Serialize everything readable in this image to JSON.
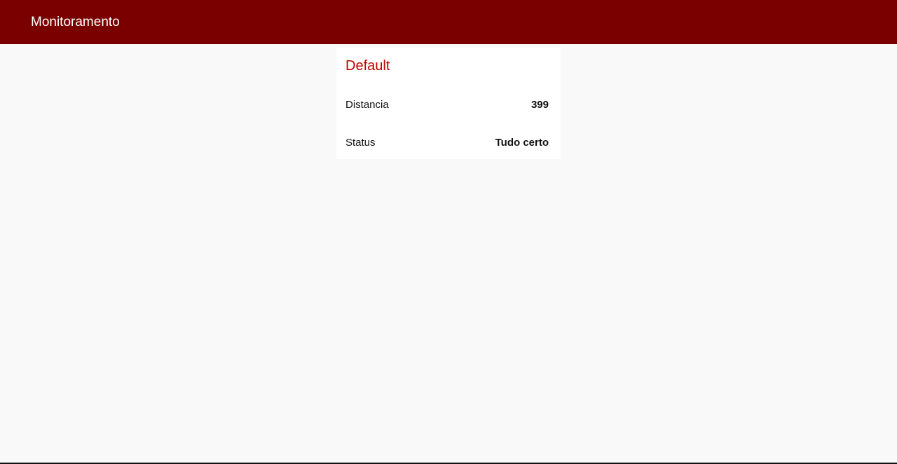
{
  "header": {
    "title": "Monitoramento",
    "background_color": "#7a0000"
  },
  "card": {
    "title": "Default",
    "title_color": "#c00000",
    "rows": [
      {
        "label": "Distancia",
        "value": "399"
      },
      {
        "label": "Status",
        "value": "Tudo certo"
      }
    ]
  }
}
